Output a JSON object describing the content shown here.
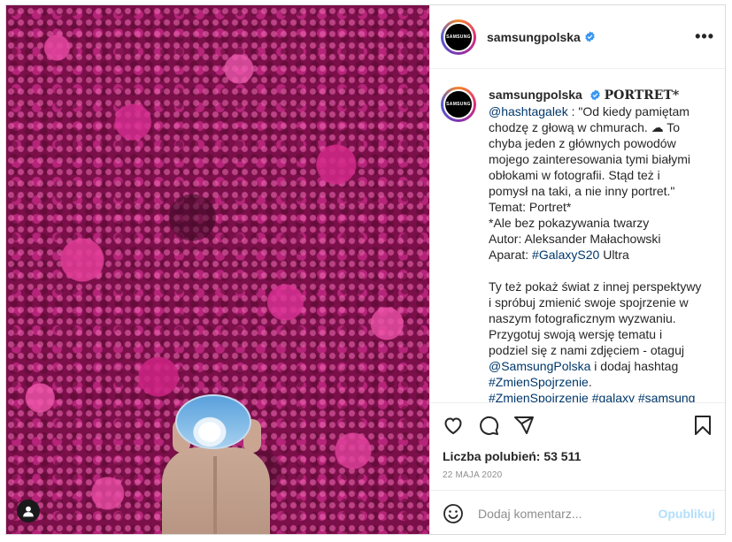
{
  "post": {
    "username": "samsungpolska",
    "avatar_text": "SAMSUNG",
    "more_icon": "•••"
  },
  "caption": {
    "username": "samsungpolska",
    "title": "PORTRET*",
    "mention": "@hashtagalek",
    "first_line_rest": " : \"Od kiedy pamiętam",
    "lines": [
      "chodzę z głową w chmurach. ☁ To",
      "chyba jeden z głównych powodów",
      "mojego zainteresowania tymi białymi",
      "obłokami w fotografii. Stąd też i",
      "pomysł na taki, a nie inny portret.\"",
      "Temat: Portret*",
      "*Ale bez pokazywania twarzy",
      "Autor: Aleksander Małachowski"
    ],
    "camera_prefix": "Aparat: ",
    "camera_hashtag": "#GalaxyS20",
    "camera_suffix": " Ultra",
    "paragraph2": [
      "Ty też pokaż świat z innej perspektywy",
      "i spróbuj zmienić swoje spojrzenie w",
      "naszym fotograficznym wyzwaniu.",
      "Przygotuj swoją wersję tematu i",
      "podziel się z nami zdjęciem - otaguj"
    ],
    "mention2": "@SamsungPolska",
    "mention2_suffix": " i dodaj hashtag",
    "hashtag2": "#ZmienSpojrzenie",
    "hashtag2_suffix": ".",
    "cut_line": "#ZmienSpojrzenie #galaxy #samsung"
  },
  "actions": {
    "likes_label": "Liczba polubień: 53 511",
    "date": "22 MAJA 2020",
    "icons": [
      "heart-icon",
      "comment-icon",
      "share-icon",
      "bookmark-icon"
    ]
  },
  "composer": {
    "placeholder": "Dodaj komentarz...",
    "post_label": "Opublikuj",
    "emoji_icon": "smile-icon"
  },
  "colors": {
    "link": "#00376b",
    "verified": "#3897f0",
    "publish_disabled": "#b2dffc",
    "muted": "#8e8e8e"
  }
}
